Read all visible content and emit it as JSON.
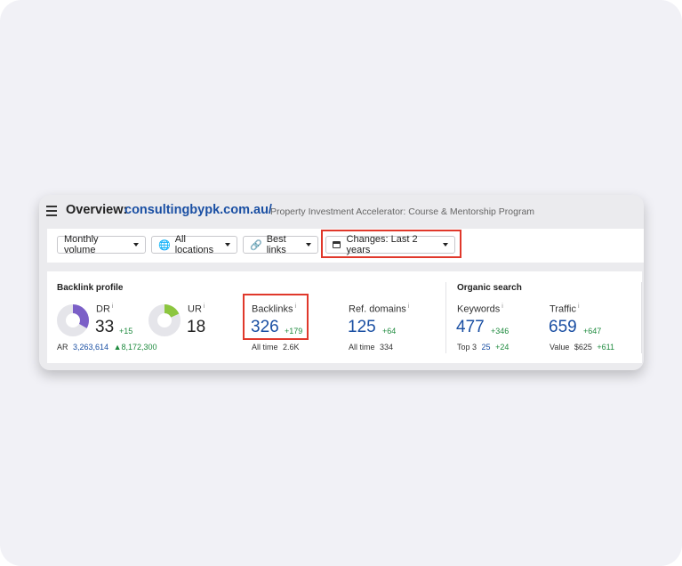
{
  "header": {
    "title_prefix": "Overview:",
    "domain": "consultingbypk.com.au/",
    "subtitle": "Property Investment Accelerator: Course & Mentorship Program"
  },
  "toolbar": {
    "volume_label": "Monthly volume",
    "locations_label": "All locations",
    "links_label": "Best links",
    "changes_label": "Changes: Last 2 years"
  },
  "backlink_profile": {
    "title": "Backlink profile",
    "dr": {
      "label": "DR",
      "info": "i",
      "value": "33",
      "delta": "+15",
      "gauge_percent": 33,
      "color": "#7b5fc7"
    },
    "ur": {
      "label": "UR",
      "info": "i",
      "value": "18",
      "gauge_percent": 18,
      "color": "#8cc63f"
    },
    "ar": {
      "label": "AR",
      "value": "3,263,614",
      "delta": "▲8,172,300"
    },
    "backlinks": {
      "label": "Backlinks",
      "info": "i",
      "value": "326",
      "delta": "+179",
      "alltime_label": "All time",
      "alltime_value": "2.6K"
    },
    "ref_domains": {
      "label": "Ref. domains",
      "info": "i",
      "value": "125",
      "delta": "+64",
      "alltime_label": "All time",
      "alltime_value": "334"
    }
  },
  "organic_search": {
    "title": "Organic search",
    "keywords": {
      "label": "Keywords",
      "info": "i",
      "value": "477",
      "delta": "+346",
      "sub_label": "Top 3",
      "sub_value": "25",
      "sub_delta": "+24"
    },
    "traffic": {
      "label": "Traffic",
      "info": "i",
      "value": "659",
      "delta": "+647",
      "sub_label": "Value",
      "sub_value": "$625",
      "sub_delta": "+611"
    }
  },
  "colors": {
    "accent_blue": "#1a4fa3",
    "positive_green": "#1e8a3e",
    "highlight_red": "#e0382b"
  }
}
